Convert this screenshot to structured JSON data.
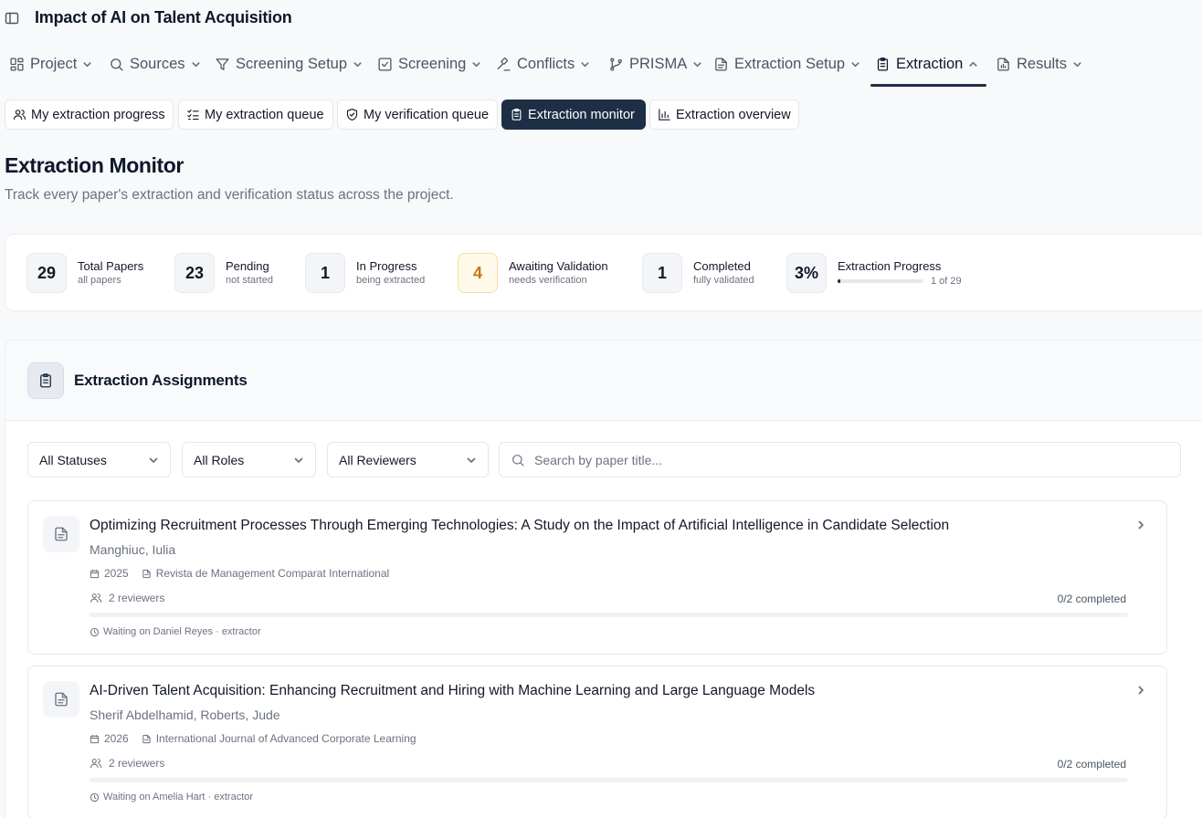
{
  "app": {
    "title": "Impact of AI on Talent Acquisition"
  },
  "nav": [
    {
      "label": "Project",
      "icon": "layout-grid-icon"
    },
    {
      "label": "Sources",
      "icon": "search-icon"
    },
    {
      "label": "Screening Setup",
      "icon": "filter-icon"
    },
    {
      "label": "Screening",
      "icon": "check-square-icon"
    },
    {
      "label": "Conflicts",
      "icon": "gavel-icon"
    },
    {
      "label": "PRISMA",
      "icon": "git-branch-icon"
    },
    {
      "label": "Extraction Setup",
      "icon": "file-text-icon"
    },
    {
      "label": "Extraction",
      "icon": "clipboard-icon",
      "active": true
    },
    {
      "label": "Results",
      "icon": "bar-chart-file-icon"
    }
  ],
  "subtabs": [
    {
      "label": "My extraction progress",
      "icon": "users-icon"
    },
    {
      "label": "My extraction queue",
      "icon": "list-checks-icon"
    },
    {
      "label": "My verification queue",
      "icon": "shield-check-icon"
    },
    {
      "label": "Extraction monitor",
      "icon": "clipboard-list-icon",
      "active": true
    },
    {
      "label": "Extraction overview",
      "icon": "bar-chart-icon"
    }
  ],
  "page": {
    "title": "Extraction Monitor",
    "subtitle": "Track every paper's extraction and verification status across the project."
  },
  "stats": [
    {
      "value": "29",
      "label": "Total Papers",
      "sub": "all papers"
    },
    {
      "value": "23",
      "label": "Pending",
      "sub": "not started"
    },
    {
      "value": "1",
      "label": "In Progress",
      "sub": "being extracted"
    },
    {
      "value": "4",
      "label": "Awaiting Validation",
      "sub": "needs verification"
    },
    {
      "value": "1",
      "label": "Completed",
      "sub": "fully validated"
    }
  ],
  "progress": {
    "value": "3%",
    "label": "Extraction Progress",
    "count": "1 of 29",
    "fraction": 0.034
  },
  "assignments": {
    "title": "Extraction Assignments",
    "filters": {
      "status": "All Statuses",
      "roles": "All Roles",
      "reviewers": "All Reviewers"
    },
    "search_placeholder": "Search by paper title...",
    "papers": [
      {
        "title": "Optimizing Recruitment Processes Through Emerging Technologies: A Study on the Impact of Artificial Intelligence in Candidate Selection",
        "authors": "Manghiuc, Iulia",
        "year": "2025",
        "journal": "Revista de Management Comparat International",
        "reviewers": "2 reviewers",
        "completed": "0/2 completed",
        "fraction": 0,
        "waiting": "Waiting on Daniel Reyes · extractor"
      },
      {
        "title": "AI-Driven Talent Acquisition: Enhancing Recruitment and Hiring with Machine Learning and Large Language Models",
        "authors": "Sherif Abdelhamid, Roberts, Jude",
        "year": "2026",
        "journal": "International Journal of Advanced Corporate Learning",
        "reviewers": "2 reviewers",
        "completed": "0/2 completed",
        "fraction": 0,
        "waiting": "Waiting on Amelia Hart · extractor"
      }
    ]
  },
  "colors": {
    "primary": "#1e2f45",
    "warning": "#c27a12",
    "warning_bg": "#fff9e9",
    "muted": "#6b7280"
  }
}
